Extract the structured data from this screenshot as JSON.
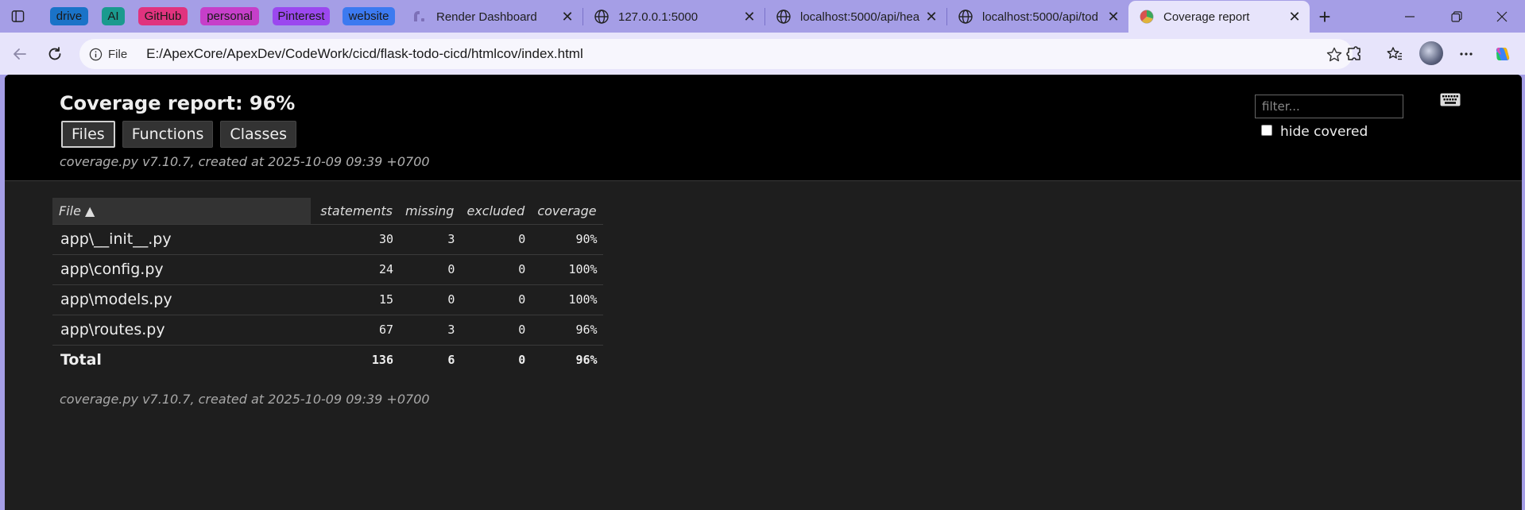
{
  "browser": {
    "groups": [
      {
        "label": "drive",
        "bg": "#1a73c8"
      },
      {
        "label": "AI",
        "bg": "#1a9a8e"
      },
      {
        "label": "GitHub",
        "bg": "#e0337e"
      },
      {
        "label": "personal",
        "bg": "#c63fc9"
      },
      {
        "label": "Pinterest",
        "bg": "#9b48ef"
      },
      {
        "label": "website",
        "bg": "#3c7af0"
      }
    ],
    "tabs": [
      {
        "title": "Render Dashboard",
        "icon": "render-icon"
      },
      {
        "title": "127.0.0.1:5000",
        "icon": "globe-icon"
      },
      {
        "title": "localhost:5000/api/hea",
        "icon": "globe-icon"
      },
      {
        "title": "localhost:5000/api/tod",
        "icon": "globe-icon"
      },
      {
        "title": "Coverage report",
        "icon": "coverage-favicon",
        "active": true
      }
    ],
    "address": {
      "scheme_label": "File",
      "url": "E:/ApexCore/ApexDev/CodeWork/cicd/flask-todo-cicd/htmlcov/index.html"
    }
  },
  "report": {
    "title": "Coverage report: 96%",
    "nav": [
      "Files",
      "Functions",
      "Classes"
    ],
    "created": "coverage.py v7.10.7, created at 2025-10-09 09:39 +0700",
    "filter_placeholder": "filter...",
    "hide_covered_label": "hide covered",
    "columns": [
      "File ▲",
      "statements",
      "missing",
      "excluded",
      "coverage"
    ],
    "rows": [
      {
        "file": "app\\__init__.py",
        "statements": "30",
        "missing": "3",
        "excluded": "0",
        "coverage": "90%"
      },
      {
        "file": "app\\config.py",
        "statements": "24",
        "missing": "0",
        "excluded": "0",
        "coverage": "100%"
      },
      {
        "file": "app\\models.py",
        "statements": "15",
        "missing": "0",
        "excluded": "0",
        "coverage": "100%"
      },
      {
        "file": "app\\routes.py",
        "statements": "67",
        "missing": "3",
        "excluded": "0",
        "coverage": "96%"
      }
    ],
    "total": {
      "file": "Total",
      "statements": "136",
      "missing": "6",
      "excluded": "0",
      "coverage": "96%"
    },
    "footer": "coverage.py v7.10.7, created at 2025-10-09 09:39 +0700"
  }
}
